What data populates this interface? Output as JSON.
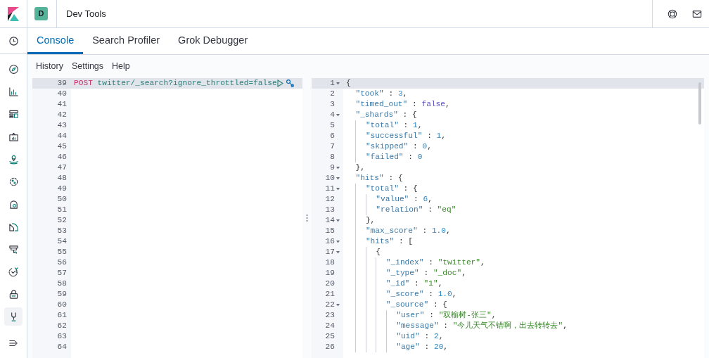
{
  "header": {
    "space_initial": "D",
    "title": "Dev Tools"
  },
  "sidebar": {
    "items": [
      {
        "selected": false
      },
      {
        "selected": false
      },
      {
        "selected": false
      },
      {
        "selected": false
      },
      {
        "selected": false
      },
      {
        "selected": false
      },
      {
        "selected": false
      },
      {
        "selected": false
      },
      {
        "selected": false
      },
      {
        "selected": false
      },
      {
        "selected": false
      },
      {
        "selected": false
      },
      {
        "selected": true
      }
    ]
  },
  "tabs": [
    {
      "label": "Console",
      "selected": true
    },
    {
      "label": "Search Profiler",
      "selected": false
    },
    {
      "label": "Grok Debugger",
      "selected": false
    }
  ],
  "toolbar": [
    "History",
    "Settings",
    "Help"
  ],
  "request_editor": {
    "lines": [
      {
        "number": "39",
        "active": true,
        "tokens": [
          {
            "kind": "method",
            "text": "POST"
          },
          {
            "kind": "url",
            "text": "twitter/_search?ignore_throttled=false"
          }
        ]
      },
      {
        "number": "40",
        "active": false
      },
      {
        "number": "41",
        "active": false
      },
      {
        "number": "42",
        "active": false
      },
      {
        "number": "43",
        "active": false
      },
      {
        "number": "44",
        "active": false
      },
      {
        "number": "45",
        "active": false
      },
      {
        "number": "46",
        "active": false
      },
      {
        "number": "47",
        "active": false
      },
      {
        "number": "48",
        "active": false
      },
      {
        "number": "49",
        "active": false
      },
      {
        "number": "50",
        "active": false
      },
      {
        "number": "51",
        "active": false
      },
      {
        "number": "52",
        "active": false
      },
      {
        "number": "53",
        "active": false
      },
      {
        "number": "54",
        "active": false
      },
      {
        "number": "55",
        "active": false
      },
      {
        "number": "56",
        "active": false
      },
      {
        "number": "57",
        "active": false
      },
      {
        "number": "58",
        "active": false
      },
      {
        "number": "59",
        "active": false
      },
      {
        "number": "60",
        "active": false
      },
      {
        "number": "61",
        "active": false
      },
      {
        "number": "62",
        "active": false
      },
      {
        "number": "63",
        "active": false
      },
      {
        "number": "64",
        "active": false
      }
    ]
  },
  "response_editor": {
    "lines": [
      {
        "number": "1",
        "foldable": true,
        "active": true,
        "tokens": [
          {
            "kind": "punct",
            "text": "{"
          }
        ]
      },
      {
        "number": "2",
        "foldable": false,
        "active": false,
        "tokens": [
          {
            "kind": "key",
            "text": "  \"took\""
          },
          {
            "kind": "punct",
            "text": " : "
          },
          {
            "kind": "number",
            "text": "3"
          },
          {
            "kind": "punct",
            "text": ","
          }
        ]
      },
      {
        "number": "3",
        "foldable": false,
        "active": false,
        "tokens": [
          {
            "kind": "key",
            "text": "  \"timed_out\""
          },
          {
            "kind": "punct",
            "text": " : "
          },
          {
            "kind": "bool",
            "text": "false"
          },
          {
            "kind": "punct",
            "text": ","
          }
        ]
      },
      {
        "number": "4",
        "foldable": true,
        "active": false,
        "tokens": [
          {
            "kind": "key",
            "text": "  \"_shards\""
          },
          {
            "kind": "punct",
            "text": " : {"
          }
        ]
      },
      {
        "number": "5",
        "foldable": false,
        "active": false,
        "tokens": [
          {
            "kind": "key",
            "text": "    \"total\""
          },
          {
            "kind": "punct",
            "text": " : "
          },
          {
            "kind": "number",
            "text": "1"
          },
          {
            "kind": "punct",
            "text": ","
          }
        ]
      },
      {
        "number": "6",
        "foldable": false,
        "active": false,
        "tokens": [
          {
            "kind": "key",
            "text": "    \"successful\""
          },
          {
            "kind": "punct",
            "text": " : "
          },
          {
            "kind": "number",
            "text": "1"
          },
          {
            "kind": "punct",
            "text": ","
          }
        ]
      },
      {
        "number": "7",
        "foldable": false,
        "active": false,
        "tokens": [
          {
            "kind": "key",
            "text": "    \"skipped\""
          },
          {
            "kind": "punct",
            "text": " : "
          },
          {
            "kind": "number",
            "text": "0"
          },
          {
            "kind": "punct",
            "text": ","
          }
        ]
      },
      {
        "number": "8",
        "foldable": false,
        "active": false,
        "tokens": [
          {
            "kind": "key",
            "text": "    \"failed\""
          },
          {
            "kind": "punct",
            "text": " : "
          },
          {
            "kind": "number",
            "text": "0"
          }
        ]
      },
      {
        "number": "9",
        "foldable": true,
        "active": false,
        "tokens": [
          {
            "kind": "punct",
            "text": "  },"
          }
        ]
      },
      {
        "number": "10",
        "foldable": true,
        "active": false,
        "tokens": [
          {
            "kind": "key",
            "text": "  \"hits\""
          },
          {
            "kind": "punct",
            "text": " : {"
          }
        ]
      },
      {
        "number": "11",
        "foldable": true,
        "active": false,
        "tokens": [
          {
            "kind": "key",
            "text": "    \"total\""
          },
          {
            "kind": "punct",
            "text": " : {"
          }
        ]
      },
      {
        "number": "12",
        "foldable": false,
        "active": false,
        "tokens": [
          {
            "kind": "key",
            "text": "      \"value\""
          },
          {
            "kind": "punct",
            "text": " : "
          },
          {
            "kind": "number",
            "text": "6"
          },
          {
            "kind": "punct",
            "text": ","
          }
        ]
      },
      {
        "number": "13",
        "foldable": false,
        "active": false,
        "tokens": [
          {
            "kind": "key",
            "text": "      \"relation\""
          },
          {
            "kind": "punct",
            "text": " : "
          },
          {
            "kind": "string",
            "text": "\"eq\""
          }
        ]
      },
      {
        "number": "14",
        "foldable": true,
        "active": false,
        "tokens": [
          {
            "kind": "punct",
            "text": "    },"
          }
        ]
      },
      {
        "number": "15",
        "foldable": false,
        "active": false,
        "tokens": [
          {
            "kind": "key",
            "text": "    \"max_score\""
          },
          {
            "kind": "punct",
            "text": " : "
          },
          {
            "kind": "number",
            "text": "1.0"
          },
          {
            "kind": "punct",
            "text": ","
          }
        ]
      },
      {
        "number": "16",
        "foldable": true,
        "active": false,
        "tokens": [
          {
            "kind": "key",
            "text": "    \"hits\""
          },
          {
            "kind": "punct",
            "text": " : ["
          }
        ]
      },
      {
        "number": "17",
        "foldable": true,
        "active": false,
        "tokens": [
          {
            "kind": "punct",
            "text": "      {"
          }
        ]
      },
      {
        "number": "18",
        "foldable": false,
        "active": false,
        "tokens": [
          {
            "kind": "key",
            "text": "        \"_index\""
          },
          {
            "kind": "punct",
            "text": " : "
          },
          {
            "kind": "string",
            "text": "\"twitter\""
          },
          {
            "kind": "punct",
            "text": ","
          }
        ]
      },
      {
        "number": "19",
        "foldable": false,
        "active": false,
        "tokens": [
          {
            "kind": "key",
            "text": "        \"_type\""
          },
          {
            "kind": "punct",
            "text": " : "
          },
          {
            "kind": "string",
            "text": "\"_doc\""
          },
          {
            "kind": "punct",
            "text": ","
          }
        ]
      },
      {
        "number": "20",
        "foldable": false,
        "active": false,
        "tokens": [
          {
            "kind": "key",
            "text": "        \"_id\""
          },
          {
            "kind": "punct",
            "text": " : "
          },
          {
            "kind": "string",
            "text": "\"1\""
          },
          {
            "kind": "punct",
            "text": ","
          }
        ]
      },
      {
        "number": "21",
        "foldable": false,
        "active": false,
        "tokens": [
          {
            "kind": "key",
            "text": "        \"_score\""
          },
          {
            "kind": "punct",
            "text": " : "
          },
          {
            "kind": "number",
            "text": "1.0"
          },
          {
            "kind": "punct",
            "text": ","
          }
        ]
      },
      {
        "number": "22",
        "foldable": true,
        "active": false,
        "tokens": [
          {
            "kind": "key",
            "text": "        \"_source\""
          },
          {
            "kind": "punct",
            "text": " : {"
          }
        ]
      },
      {
        "number": "23",
        "foldable": false,
        "active": false,
        "tokens": [
          {
            "kind": "key",
            "text": "          \"user\""
          },
          {
            "kind": "punct",
            "text": " : "
          },
          {
            "kind": "string",
            "text": "\"双榆树-张三\""
          },
          {
            "kind": "punct",
            "text": ","
          }
        ]
      },
      {
        "number": "24",
        "foldable": false,
        "active": false,
        "tokens": [
          {
            "kind": "key",
            "text": "          \"message\""
          },
          {
            "kind": "punct",
            "text": " : "
          },
          {
            "kind": "string",
            "text": "\"今儿天气不错啊，出去转转去\""
          },
          {
            "kind": "punct",
            "text": ","
          }
        ]
      },
      {
        "number": "25",
        "foldable": false,
        "active": false,
        "tokens": [
          {
            "kind": "key",
            "text": "          \"uid\""
          },
          {
            "kind": "punct",
            "text": " : "
          },
          {
            "kind": "number",
            "text": "2"
          },
          {
            "kind": "punct",
            "text": ","
          }
        ]
      },
      {
        "number": "26",
        "foldable": false,
        "active": false,
        "tokens": [
          {
            "kind": "key",
            "text": "          \"age\""
          },
          {
            "kind": "punct",
            "text": " : "
          },
          {
            "kind": "number",
            "text": "20"
          },
          {
            "kind": "punct",
            "text": ","
          }
        ]
      }
    ]
  }
}
